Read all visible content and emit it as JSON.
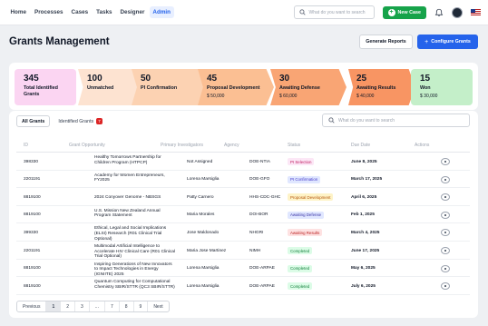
{
  "nav": {
    "items": [
      "Home",
      "Processes",
      "Cases",
      "Tasks",
      "Designer",
      "Admin"
    ],
    "active_index": 5,
    "search_placeholder": "What do you want to search",
    "new_case_label": "New Case"
  },
  "header": {
    "title": "Grants Management",
    "generate_reports": "Generate Reports",
    "configure_grants": "Configure Grants"
  },
  "stats": [
    {
      "num": "345",
      "label": "Total Identified Grants",
      "amount": ""
    },
    {
      "num": "100",
      "label": "Unmatched",
      "amount": ""
    },
    {
      "num": "50",
      "label": "PI Confirmation",
      "amount": ""
    },
    {
      "num": "45",
      "label": "Proposal Development",
      "amount": "$ 50,000"
    },
    {
      "num": "30",
      "label": "Awaiting Defense",
      "amount": "$ 60,000"
    },
    {
      "num": "25",
      "label": "Awaiting Results",
      "amount": "$ 40,000"
    },
    {
      "num": "15",
      "label": "Won",
      "amount": "$ 30,000"
    }
  ],
  "tabs": {
    "all": "All Grants",
    "identified": "Identified Grants",
    "identified_badge": "7",
    "search_placeholder": "What do you want to search"
  },
  "table": {
    "columns": [
      "ID",
      "Grant Opportunity",
      "Primary Investigators",
      "Agency",
      "Status",
      "Due Date",
      "Actions"
    ],
    "rows": [
      {
        "id": "398330",
        "opportunity": "Healthy Tomorrows Partnership for Children Program (HTPCP)",
        "pi": "Not Assigned",
        "agency": "DOE-NTIA",
        "status": "PI Selection",
        "status_key": "pi",
        "due": "June 8, 2025"
      },
      {
        "id": "2201191",
        "opportunity": "Academy for Women Entrepreneurs, FY2025",
        "pi": "Lorena Marsiglia",
        "agency": "DOE-GFO",
        "status": "PI Confirmation",
        "status_key": "pic",
        "due": "March 17, 2025"
      },
      {
        "id": "8819100",
        "opportunity": "2024 Conyover Genome - NBSGS",
        "pi": "Patty Carnero",
        "agency": "HHS-CDC-GHC",
        "status": "Proposal Development",
        "status_key": "prop",
        "due": "April 6, 2025"
      },
      {
        "id": "8819100",
        "opportunity": "U.S. Mission New Zealand Annual Program Statement",
        "pi": "Maria Morales",
        "agency": "DOI-BOR",
        "status": "Awaiting Defense",
        "status_key": "def",
        "due": "Feb 1, 2025"
      },
      {
        "id": "399330",
        "opportunity": "Ethical, Legal and Social Implications (ELSI) Research (R01 Clinical Trial Optional)",
        "pi": "Jose Maldonado",
        "agency": "NHGRI",
        "status": "Awaiting Results",
        "status_key": "res",
        "due": "March 4, 2025"
      },
      {
        "id": "2201191",
        "opportunity": "Multimodal Artificial Intelligence to Accelerate HIV Clinical Care (R01 Clinical Trial Optional)",
        "pi": "Maria Jose Martinez",
        "agency": "NIMH",
        "status": "Completed",
        "status_key": "done",
        "due": "June 17, 2025"
      },
      {
        "id": "8819100",
        "opportunity": "Inspiring Generations of New Innovators to Impact Technologies in Energy (IGNIITE) 2025",
        "pi": "Lorena Marsiglia",
        "agency": "DOE-ARPAE",
        "status": "Completed",
        "status_key": "done",
        "due": "May 6, 2025"
      },
      {
        "id": "8819100",
        "opportunity": "Quantum Computing for Computational Chemistry SBIR/STTR (QC3 SBIR/STTR)",
        "pi": "Lorena Marsiglia",
        "agency": "DOE-ARPAE",
        "status": "Completed",
        "status_key": "done",
        "due": "July 6, 2025"
      }
    ]
  },
  "pagination": {
    "previous": "Previous",
    "pages": [
      "1",
      "2",
      "3",
      "...",
      "7",
      "8",
      "9"
    ],
    "current": "1",
    "next": "Next"
  },
  "status_colors": {
    "pi": {
      "bg": "#fce7f6",
      "fg": "#be185d"
    },
    "pic": {
      "bg": "#e0e7ff",
      "fg": "#4338ca"
    },
    "prop": {
      "bg": "#fef3c7",
      "fg": "#b45309"
    },
    "def": {
      "bg": "#e0e7ff",
      "fg": "#3730a3"
    },
    "res": {
      "bg": "#fee2e2",
      "fg": "#b91c1c"
    },
    "done": {
      "bg": "#dcfce7",
      "fg": "#15803d"
    }
  }
}
